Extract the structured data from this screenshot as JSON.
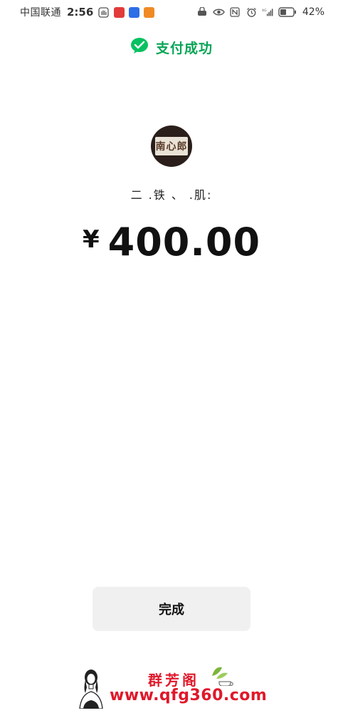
{
  "status_bar": {
    "carrier": "中国联通",
    "time": "2:56",
    "network": "4G",
    "battery": "42%"
  },
  "header": {
    "success_text": "支付成功",
    "success_color": "#07a555",
    "icon": "wechat-pay-icon"
  },
  "merchant": {
    "logo_text": "南心郎",
    "name": "二  .铁  、 .肌:"
  },
  "payment": {
    "currency_symbol": "¥",
    "amount": "400.00"
  },
  "actions": {
    "done_label": "完成"
  },
  "watermark": {
    "title": "群芳阁",
    "url": "www.qfg360.com",
    "color": "#e0182a"
  }
}
